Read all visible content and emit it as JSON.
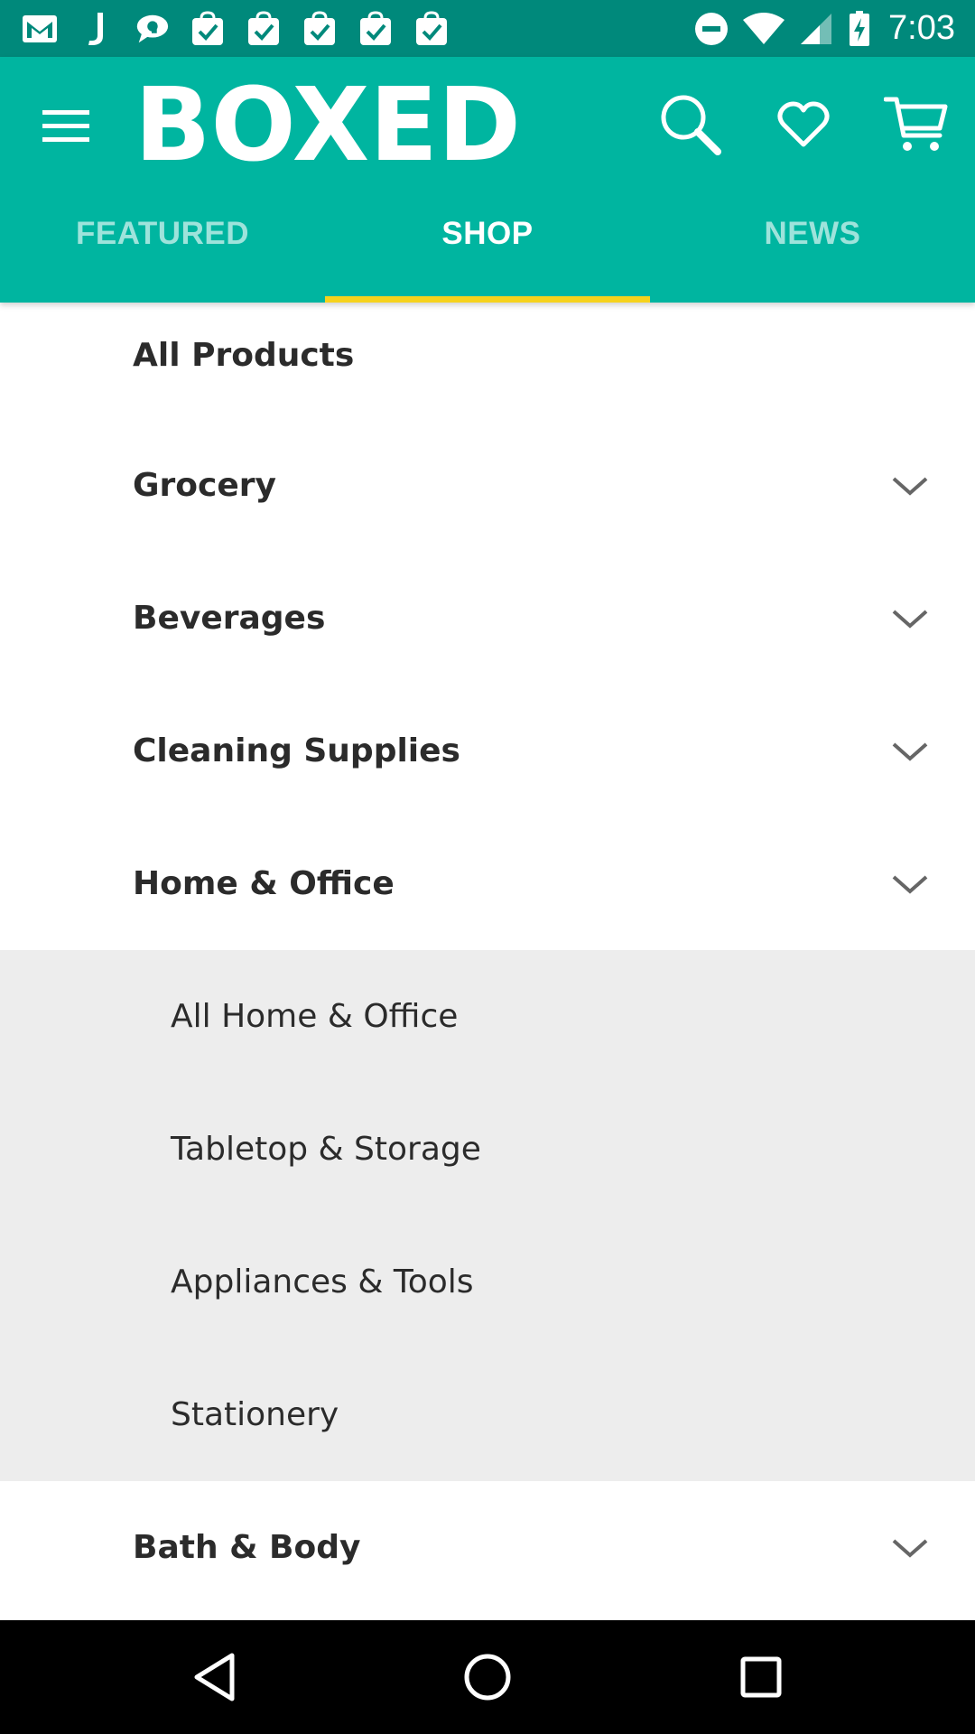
{
  "status_bar": {
    "time": "7:03",
    "notification_icons": [
      "gmail-icon",
      "j-app-icon",
      "chat-bubble-icon",
      "task-bag-icon",
      "task-bag-icon",
      "task-bag-icon",
      "task-bag-icon",
      "task-bag-icon"
    ],
    "system_icons": [
      "do-not-disturb-icon",
      "wifi-icon",
      "cell-signal-icon",
      "battery-charging-icon"
    ]
  },
  "app_bar": {
    "logo_text": "BOXED",
    "menu_icon": "hamburger-menu-icon",
    "action_icons": [
      "search-icon",
      "heart-icon",
      "cart-icon"
    ],
    "colors": {
      "status_bar": "#00897b",
      "toolbar": "#00b5a0",
      "tab_indicator": "#f6d21c"
    }
  },
  "tabs": [
    {
      "label": "FEATURED",
      "active": false
    },
    {
      "label": "SHOP",
      "active": true
    },
    {
      "label": "NEWS",
      "active": false
    }
  ],
  "categories": {
    "all_products": "All Products",
    "grocery": "Grocery",
    "beverages": "Beverages",
    "cleaning_supplies": "Cleaning Supplies",
    "home_office": "Home & Office",
    "bath_body": "Bath & Body"
  },
  "home_office_subcategories": [
    "All Home & Office",
    "Tabletop & Storage",
    "Appliances & Tools",
    "Stationery"
  ],
  "nav_bar": {
    "icons": [
      "back-icon",
      "home-icon",
      "recent-apps-icon"
    ]
  }
}
